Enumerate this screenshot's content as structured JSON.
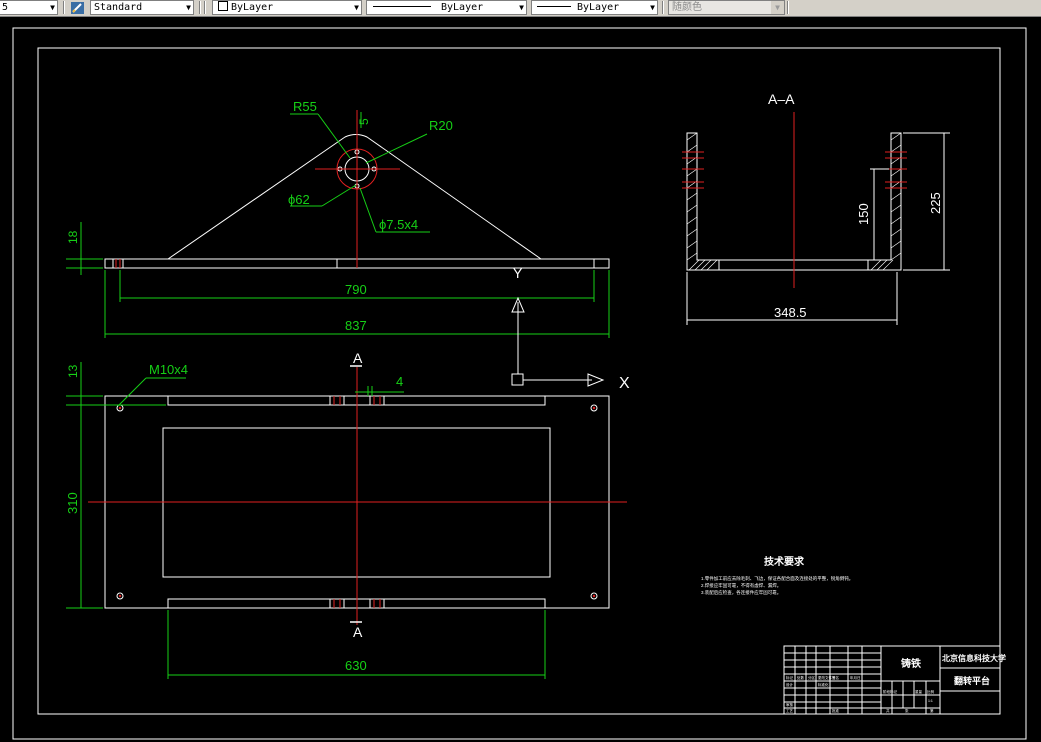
{
  "toolbar": {
    "combo_left": "5",
    "text_style": "Standard",
    "layer": "ByLayer",
    "linetype": "ByLayer",
    "lineweight": "ByLayer",
    "plot_style": "随颜色"
  },
  "drawing": {
    "dims": {
      "r55": "R55",
      "r20": "R20",
      "d5": "5",
      "phi62": "ϕ62",
      "phi7": "ϕ7.5x4",
      "d18": "18",
      "d790": "790",
      "d837": "837",
      "d13": "13",
      "m10": "M10x4",
      "d4": "4",
      "d310": "310",
      "d630": "630",
      "d225": "225",
      "d150": "150",
      "d348": "348.5"
    },
    "section_label": "A–A",
    "cut_a_top": "A",
    "cut_a_bottom": "A",
    "ucs_x": "X",
    "ucs_y": "Y",
    "tech_title": "技术要求",
    "tech_notes": [
      "1.零件加工前应去除毛刺、飞边，保证各配合面及连接处的平整，锐角倒钝。",
      "2.焊接应牢固可靠，不得有虚焊、漏焊。",
      "3.装配后应检查，各连接件应牢固可靠。"
    ],
    "title_block": {
      "material": "铸铁",
      "school": "北京信息科技大学",
      "part_name": "翻转平台",
      "cells": [
        "标记",
        "处数",
        "分区",
        "更改文件号",
        "签名",
        "年月日",
        "设计",
        "标准化",
        "审核",
        "工艺",
        "批准",
        "阶段标记",
        "重量",
        "比例",
        "1:1",
        "共",
        "张",
        "第"
      ]
    }
  }
}
